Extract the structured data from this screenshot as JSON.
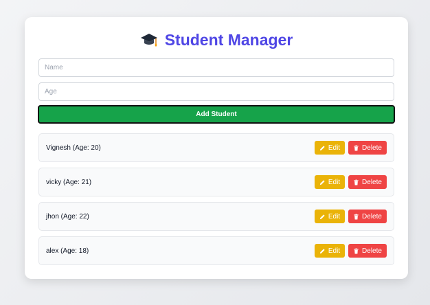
{
  "header": {
    "icon": "graduation-cap-icon",
    "title": "Student Manager",
    "accent_color": "#4f46e5"
  },
  "form": {
    "name_placeholder": "Name",
    "name_value": "",
    "age_placeholder": "Age",
    "age_value": "",
    "add_label": "Add Student",
    "add_color": "#16a34a"
  },
  "students": [
    {
      "text": "Vignesh (Age: 20)",
      "edit_label": "Edit",
      "delete_label": "Delete"
    },
    {
      "text": "vicky (Age: 21)",
      "edit_label": "Edit",
      "delete_label": "Delete"
    },
    {
      "text": "jhon (Age: 22)",
      "edit_label": "Edit",
      "delete_label": "Delete"
    },
    {
      "text": "alex (Age: 18)",
      "edit_label": "Edit",
      "delete_label": "Delete"
    }
  ],
  "icons": {
    "edit": "pencil-icon",
    "delete": "trash-icon"
  },
  "colors": {
    "edit": "#eab308",
    "delete": "#ef4444"
  }
}
